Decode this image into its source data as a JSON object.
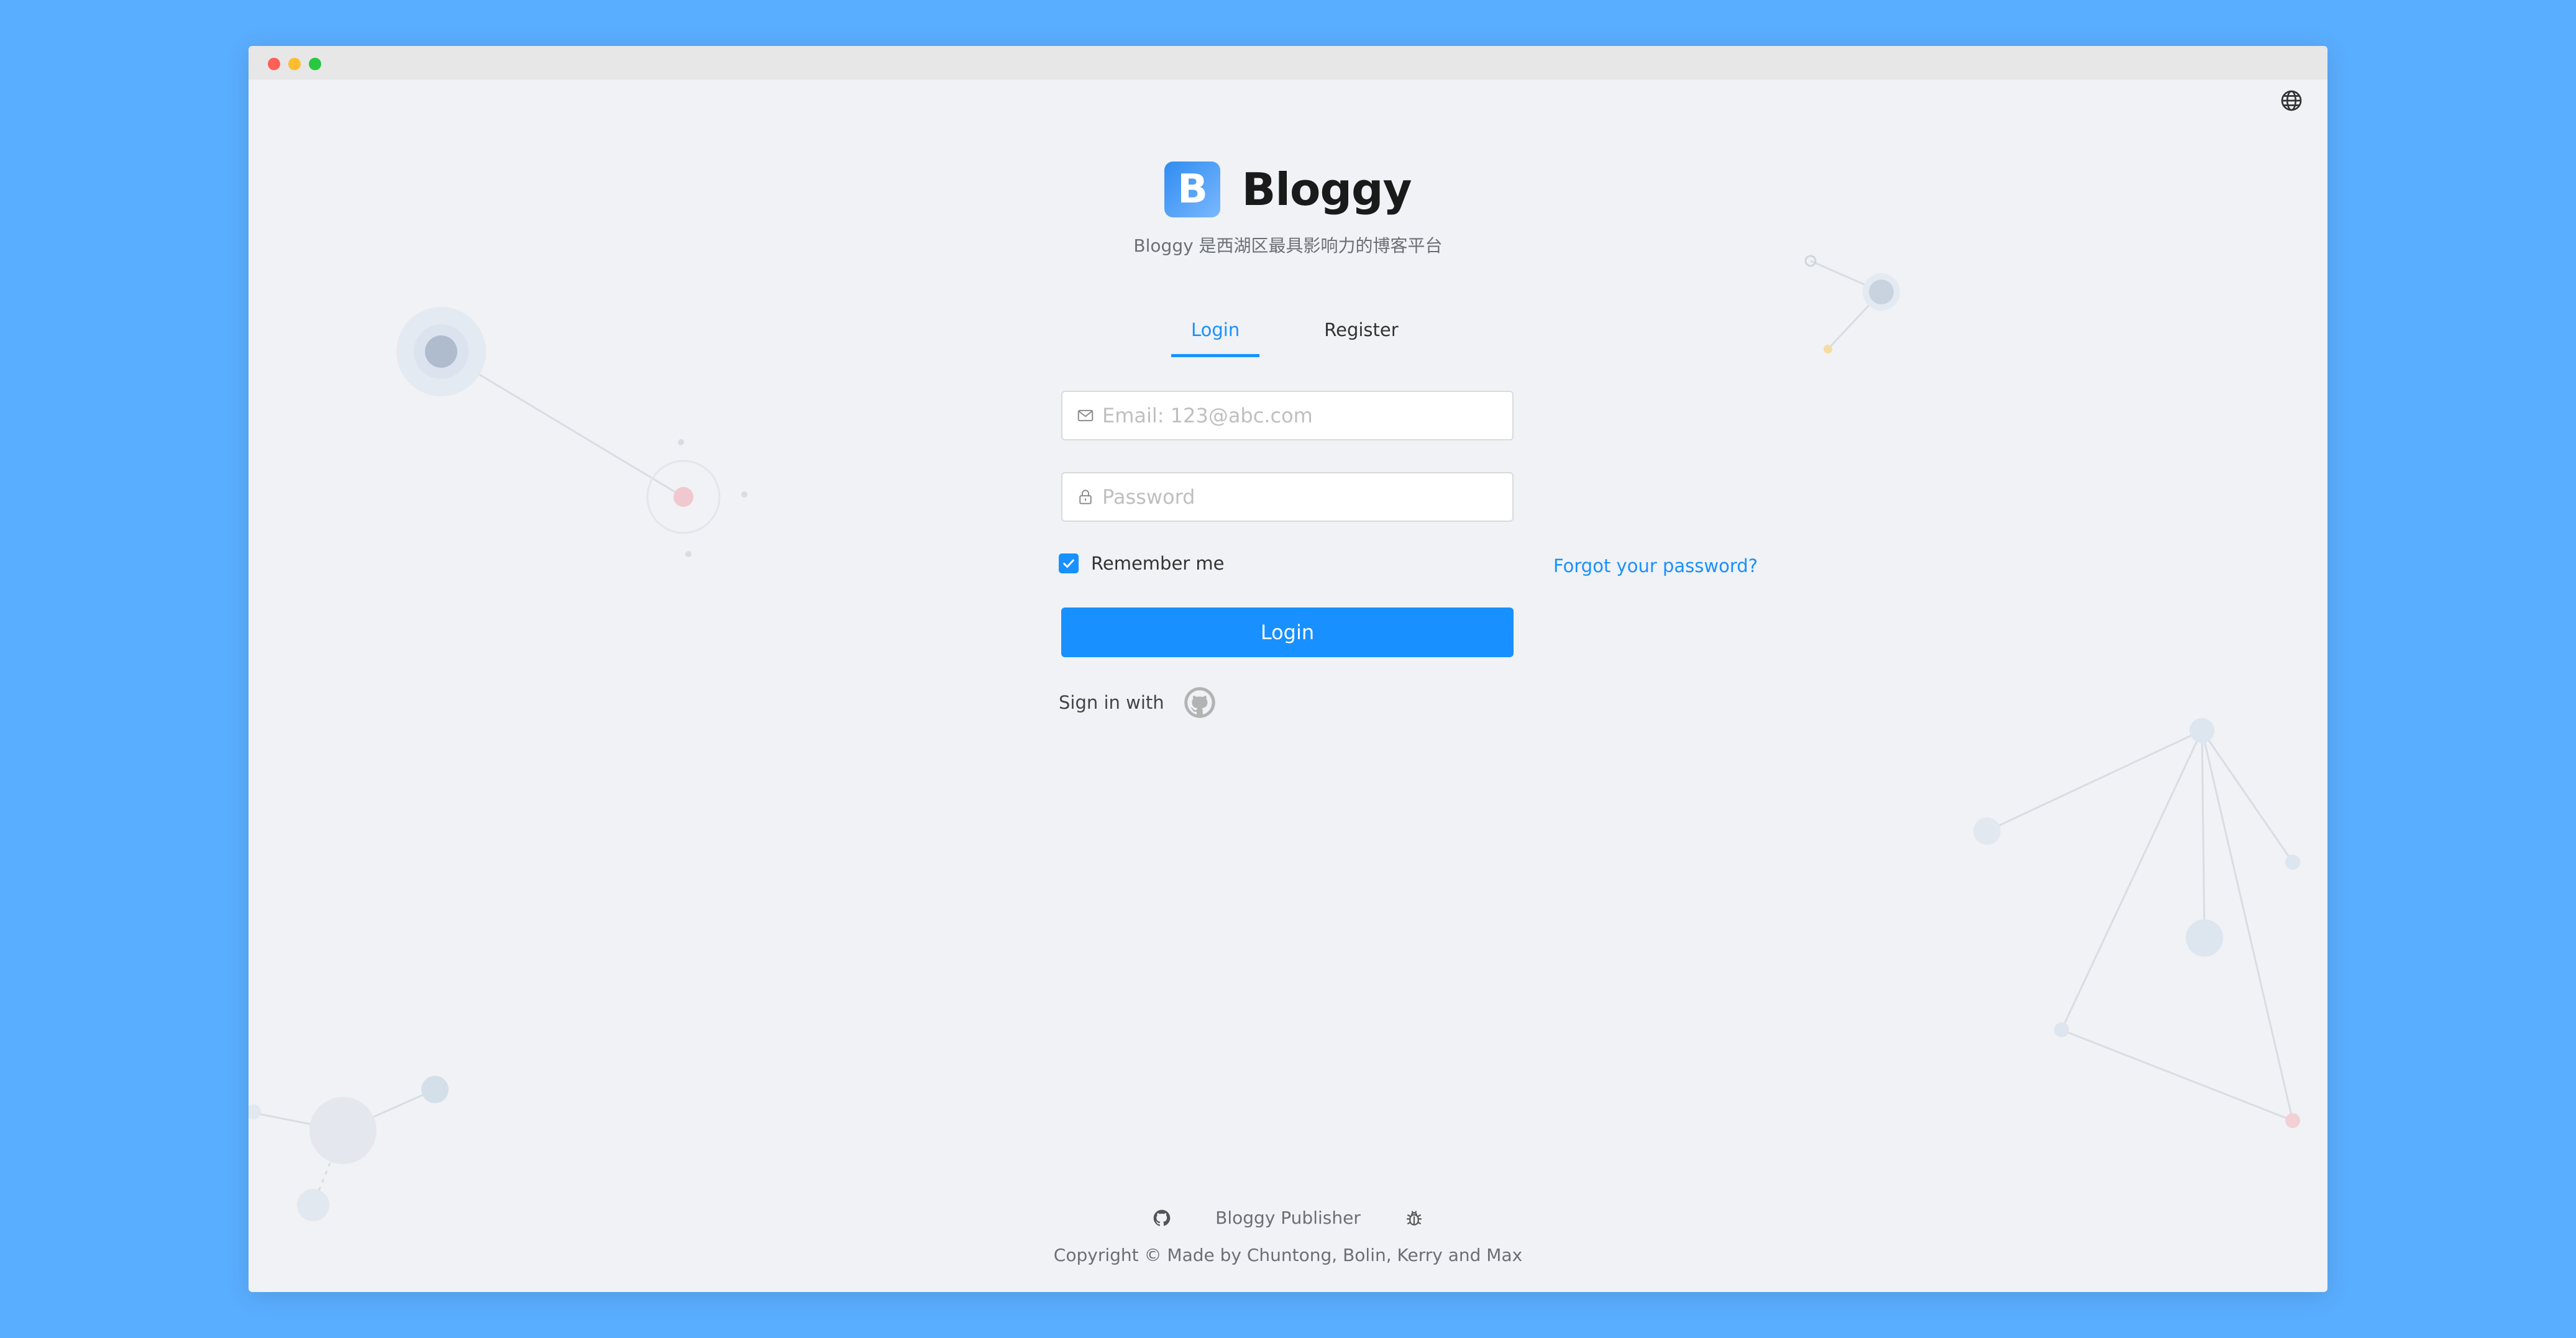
{
  "app": {
    "name": "Bloggy",
    "logo_letter": "B",
    "tagline": "Bloggy 是西湖区最具影响力的博客平台"
  },
  "tabs": [
    {
      "label": "Login",
      "active": true
    },
    {
      "label": "Register",
      "active": false
    }
  ],
  "form": {
    "email_placeholder": "Email: 123@abc.com",
    "email_value": "",
    "password_placeholder": "Password",
    "password_value": "",
    "remember_label": "Remember me",
    "remember_checked": true,
    "forgot_label": "Forgot your password?",
    "login_button": "Login",
    "signin_with": "Sign in with"
  },
  "footer": {
    "publisher": "Bloggy Publisher",
    "copyright": "Copyright © Made by Chuntong, Bolin, Kerry and Max"
  },
  "icons": {
    "language": "globe-icon",
    "email": "mail-icon",
    "password": "lock-icon",
    "remember": "check-icon",
    "oauth": "github-icon",
    "footer_left": "github-icon",
    "footer_right": "bug-icon"
  },
  "colors": {
    "accent": "#1890ff",
    "background": "#5aaeff",
    "window": "#f0f2f5"
  }
}
